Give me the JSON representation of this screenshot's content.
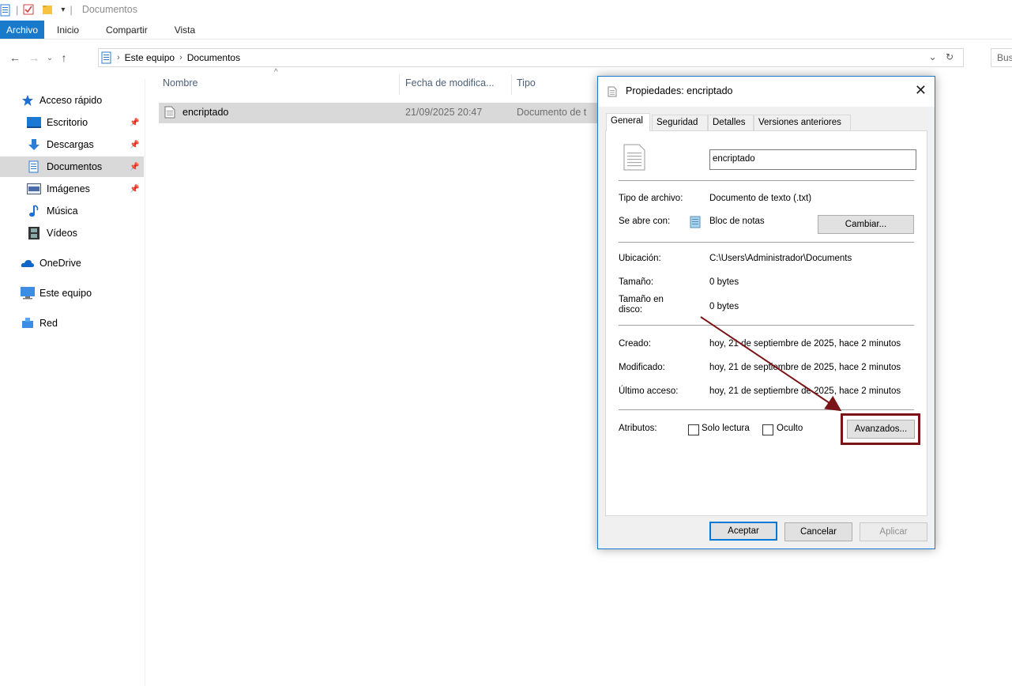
{
  "window": {
    "title": "Documentos"
  },
  "ribbon": {
    "tabs": [
      "Archivo",
      "Inicio",
      "Compartir",
      "Vista"
    ]
  },
  "address": {
    "crumbs": [
      "Este equipo",
      "Documentos"
    ],
    "search_placeholder": "Bus"
  },
  "sidebar": {
    "items": [
      {
        "label": "Acceso rápido",
        "icon": "star-icon"
      },
      {
        "label": "Escritorio",
        "icon": "desktop-icon",
        "pinned": true
      },
      {
        "label": "Descargas",
        "icon": "download-icon",
        "pinned": true
      },
      {
        "label": "Documentos",
        "icon": "documents-icon",
        "pinned": true,
        "selected": true
      },
      {
        "label": "Imágenes",
        "icon": "pictures-icon",
        "pinned": true
      },
      {
        "label": "Música",
        "icon": "music-icon"
      },
      {
        "label": "Vídeos",
        "icon": "videos-icon"
      },
      {
        "label": "OneDrive",
        "icon": "onedrive-icon"
      },
      {
        "label": "Este equipo",
        "icon": "computer-icon"
      },
      {
        "label": "Red",
        "icon": "network-icon"
      }
    ]
  },
  "filelist": {
    "columns": [
      "Nombre",
      "Fecha de modifica...",
      "Tipo"
    ],
    "rows": [
      {
        "name": "encriptado",
        "date": "21/09/2025 20:47",
        "type": "Documento de t"
      }
    ]
  },
  "dialog": {
    "title": "Propiedades: encriptado",
    "tabs": [
      "General",
      "Seguridad",
      "Detalles",
      "Versiones anteriores"
    ],
    "file_name": "encriptado",
    "labels": {
      "type": "Tipo de archivo:",
      "opens_with": "Se abre con:",
      "location": "Ubicación:",
      "size": "Tamaño:",
      "size_on_disk": "Tamaño en disco:",
      "created": "Creado:",
      "modified": "Modificado:",
      "accessed": "Último acceso:",
      "attributes": "Atributos:"
    },
    "values": {
      "type": "Documento de texto (.txt)",
      "opens_with": "Bloc de notas",
      "location": "C:\\Users\\Administrador\\Documents",
      "size": "0 bytes",
      "size_on_disk": "0 bytes",
      "created": "hoy, 21 de septiembre de 2025, hace 2 minutos",
      "modified": "hoy, 21 de septiembre de 2025, hace 2 minutos",
      "accessed": "hoy, 21 de septiembre de 2025, hace 2 minutos"
    },
    "checkboxes": {
      "readonly": "Solo lectura",
      "hidden": "Oculto"
    },
    "buttons": {
      "change": "Cambiar...",
      "advanced": "Avanzados...",
      "ok": "Aceptar",
      "cancel": "Cancelar",
      "apply": "Aplicar"
    }
  },
  "annotation": {
    "color": "#7a1416"
  }
}
